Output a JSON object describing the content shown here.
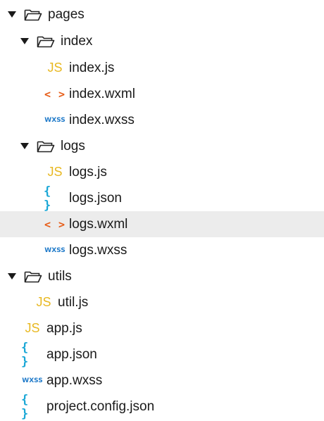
{
  "tree": [
    {
      "type": "folder",
      "label": "pages",
      "depth": 0,
      "expanded": true
    },
    {
      "type": "folder",
      "label": "index",
      "depth": 1,
      "expanded": true
    },
    {
      "type": "file",
      "label": "index.js",
      "depth": 2,
      "icon": "js-icon",
      "icon_text": "JS"
    },
    {
      "type": "file",
      "label": "index.wxml",
      "depth": 2,
      "icon": "wxml-icon",
      "icon_text": "< >"
    },
    {
      "type": "file",
      "label": "index.wxss",
      "depth": 2,
      "icon": "wxss-icon",
      "icon_text": "WXSS"
    },
    {
      "type": "folder",
      "label": "logs",
      "depth": 1,
      "expanded": true
    },
    {
      "type": "file",
      "label": "logs.js",
      "depth": 2,
      "icon": "js-icon",
      "icon_text": "JS"
    },
    {
      "type": "file",
      "label": "logs.json",
      "depth": 2,
      "icon": "json-icon",
      "icon_text": "{ }"
    },
    {
      "type": "file",
      "label": "logs.wxml",
      "depth": 2,
      "icon": "wxml-icon",
      "icon_text": "< >",
      "selected": true
    },
    {
      "type": "file",
      "label": "logs.wxss",
      "depth": 2,
      "icon": "wxss-icon",
      "icon_text": "WXSS"
    },
    {
      "type": "folder",
      "label": "utils",
      "depth": 0,
      "expanded": true
    },
    {
      "type": "file",
      "label": "util.js",
      "depth": 1,
      "icon": "js-icon",
      "icon_text": "JS"
    },
    {
      "type": "file",
      "label": "app.js",
      "depth": 0,
      "icon": "js-icon",
      "icon_text": "JS"
    },
    {
      "type": "file",
      "label": "app.json",
      "depth": 0,
      "icon": "json-icon",
      "icon_text": "{ }"
    },
    {
      "type": "file",
      "label": "app.wxss",
      "depth": 0,
      "icon": "wxss-icon",
      "icon_text": "WXSS"
    },
    {
      "type": "file",
      "label": "project.config.json",
      "depth": 0,
      "icon": "json-icon",
      "icon_text": "{ }"
    }
  ],
  "colors": {
    "js": "#e8b821",
    "wxml": "#e65c17",
    "json": "#1aa7d6",
    "wxss": "#1f7ac9",
    "selected_row": "#ececec",
    "text": "#1a1a1a"
  }
}
